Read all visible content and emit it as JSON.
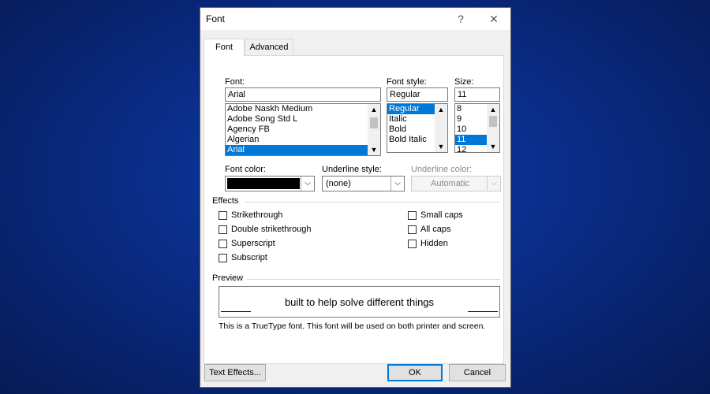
{
  "dialog": {
    "title": "Font",
    "help_glyph": "?",
    "close_glyph": "✕"
  },
  "tabs": [
    {
      "label": "Font",
      "active": true
    },
    {
      "label": "Advanced",
      "active": false
    }
  ],
  "font": {
    "label": "Font:",
    "value": "Arial",
    "items": [
      "Adobe Naskh Medium",
      "Adobe Song Std L",
      "Agency FB",
      "Algerian",
      "Arial"
    ],
    "selected": "Arial"
  },
  "style": {
    "label": "Font style:",
    "value": "Regular",
    "items": [
      "Regular",
      "Italic",
      "Bold",
      "Bold Italic"
    ],
    "selected": "Regular"
  },
  "size": {
    "label": "Size:",
    "value": "11",
    "items": [
      "8",
      "9",
      "10",
      "11",
      "12"
    ],
    "selected": "11"
  },
  "font_color": {
    "label": "Font color:",
    "value": "#000000"
  },
  "underline_style": {
    "label": "Underline style:",
    "value": "(none)"
  },
  "underline_color": {
    "label": "Underline color:",
    "value": "Automatic",
    "disabled": true
  },
  "effects": {
    "section_label": "Effects",
    "left": [
      {
        "label": "Strikethrough",
        "checked": false
      },
      {
        "label": "Double strikethrough",
        "checked": false
      },
      {
        "label": "Superscript",
        "checked": false
      },
      {
        "label": "Subscript",
        "checked": false
      }
    ],
    "right": [
      {
        "label": "Small caps",
        "checked": false
      },
      {
        "label": "All caps",
        "checked": false
      },
      {
        "label": "Hidden",
        "checked": false
      }
    ]
  },
  "preview": {
    "section_label": "Preview",
    "sample": "built to help solve different things",
    "note": "This is a TrueType font. This font will be used on both printer and screen."
  },
  "buttons": {
    "text_effects": "Text Effects...",
    "ok": "OK",
    "cancel": "Cancel"
  },
  "colors": {
    "selection": "#0078d7",
    "background": "#0a2c86"
  }
}
